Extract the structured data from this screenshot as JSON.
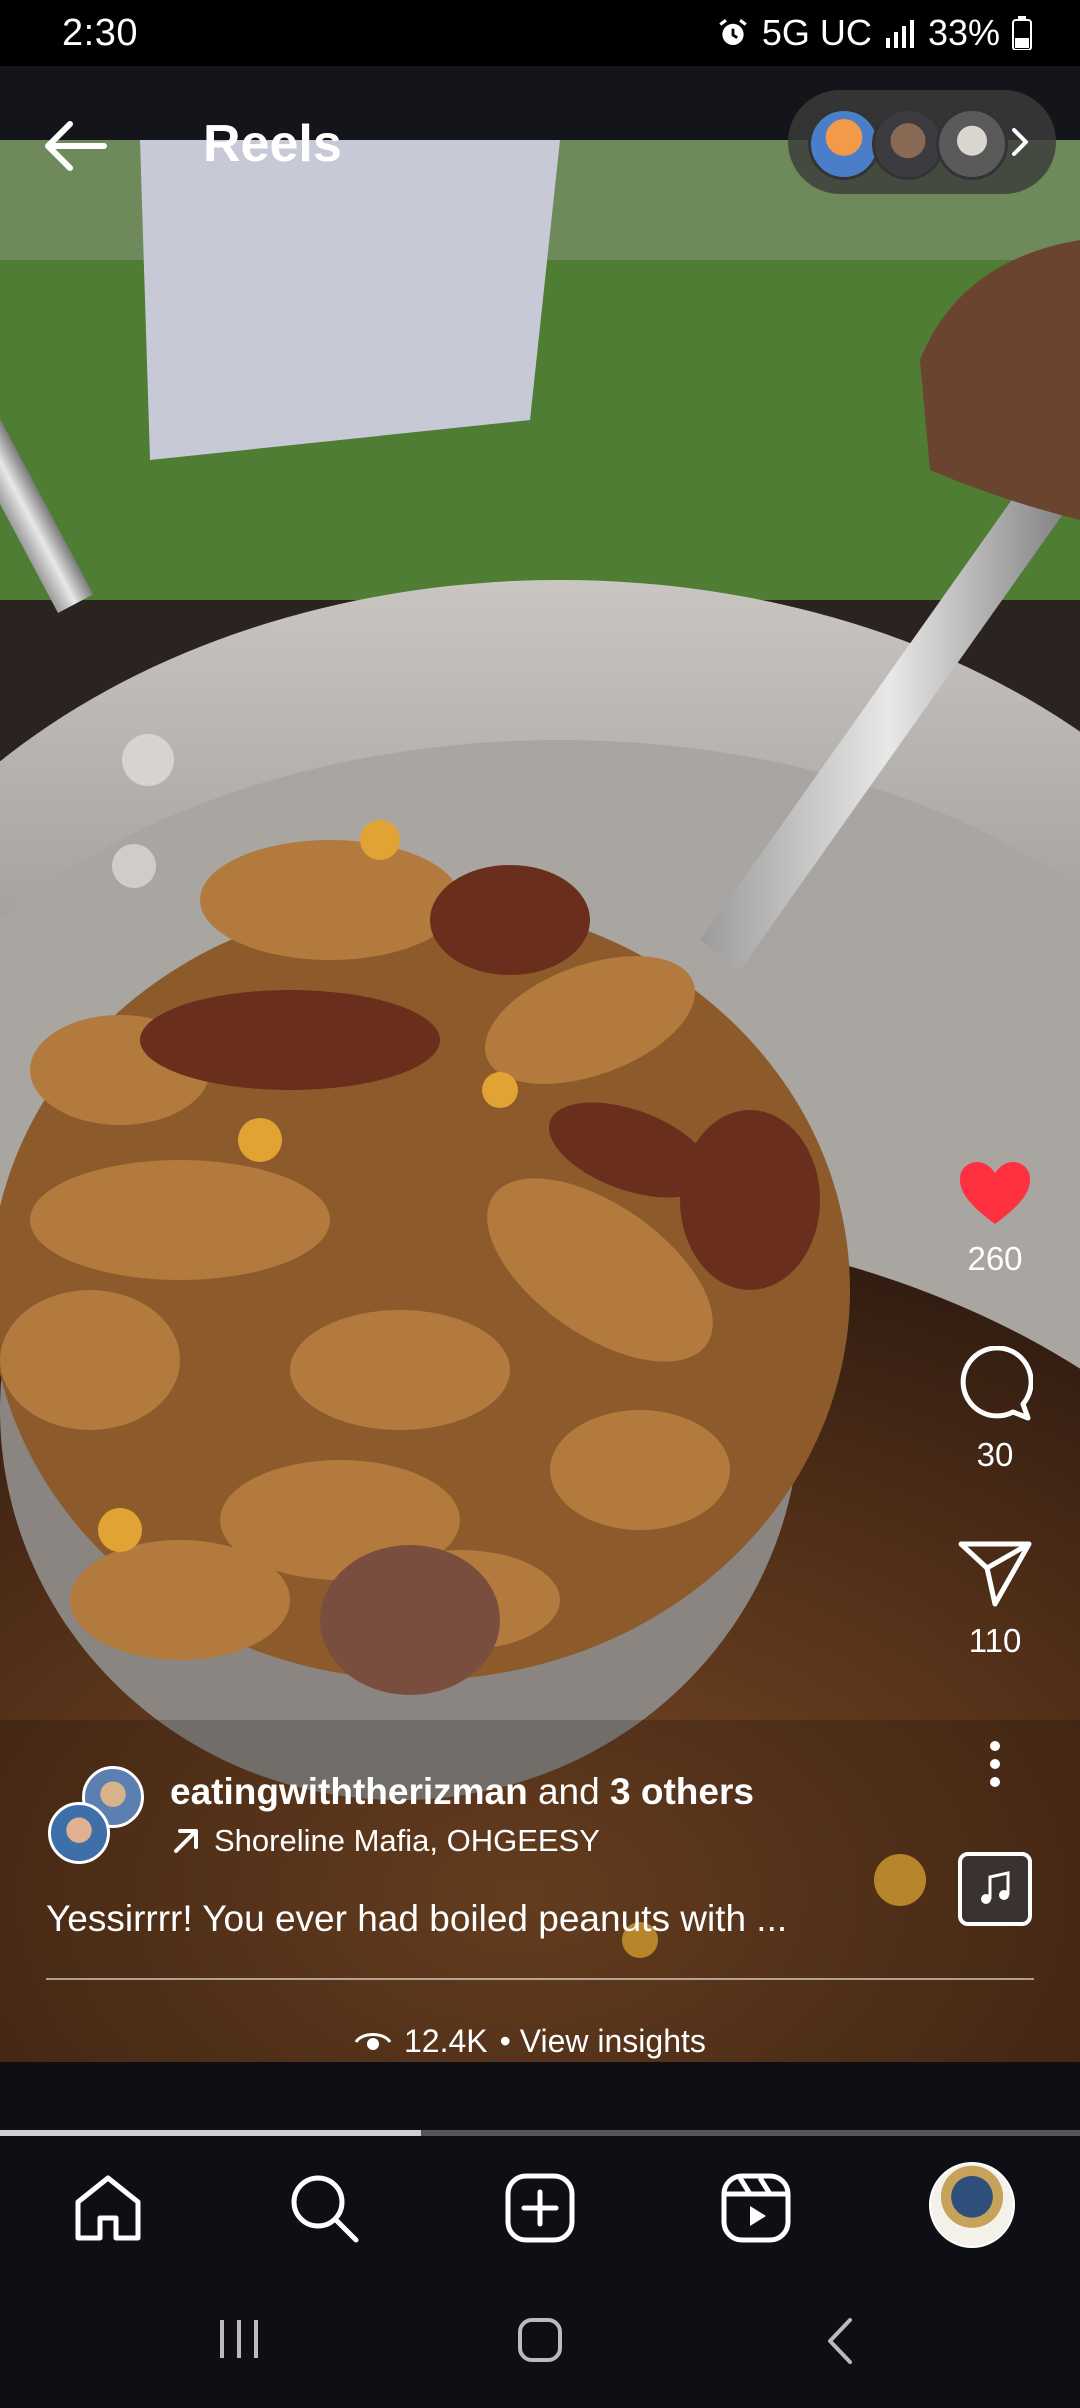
{
  "status_bar": {
    "time": "2:30",
    "network": "5G UC",
    "battery": "33%",
    "icons": [
      "alarm-icon",
      "signal-icon",
      "battery-icon"
    ]
  },
  "header": {
    "title": "Reels",
    "back_icon": "arrow-left-icon",
    "more_icon": "chevron-right-icon"
  },
  "actions": {
    "like_count": "260",
    "comment_count": "30",
    "share_count": "110",
    "like_color": "#ff3040"
  },
  "post": {
    "author": "eatingwiththerizman",
    "author_suffix": "and",
    "others": "3 others",
    "audio": "Shoreline Mafia, OHGEESY",
    "caption": "Yessirrrr! You ever had boiled peanuts with ...",
    "views": "12.4K",
    "insights_label": "• View insights"
  },
  "progress": {
    "fraction": 0.39
  },
  "nav": [
    "home-icon",
    "search-icon",
    "create-icon",
    "reels-icon",
    "profile-avatar"
  ]
}
